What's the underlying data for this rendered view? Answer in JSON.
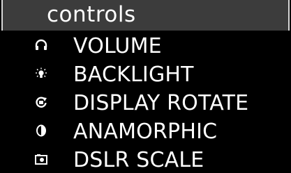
{
  "header": {
    "title": "controls"
  },
  "menu": {
    "items": [
      {
        "label": "VOLUME",
        "icon": "headphones-icon"
      },
      {
        "label": "BACKLIGHT",
        "icon": "lightbulb-icon"
      },
      {
        "label": "DISPLAY ROTATE",
        "icon": "rotate-icon"
      },
      {
        "label": "ANAMORPHIC",
        "icon": "contrast-icon"
      },
      {
        "label": "DSLR SCALE",
        "icon": "camera-icon"
      }
    ]
  },
  "colors": {
    "background": "#000000",
    "header_background": "#3c3c3c",
    "text": "#ffffff"
  }
}
